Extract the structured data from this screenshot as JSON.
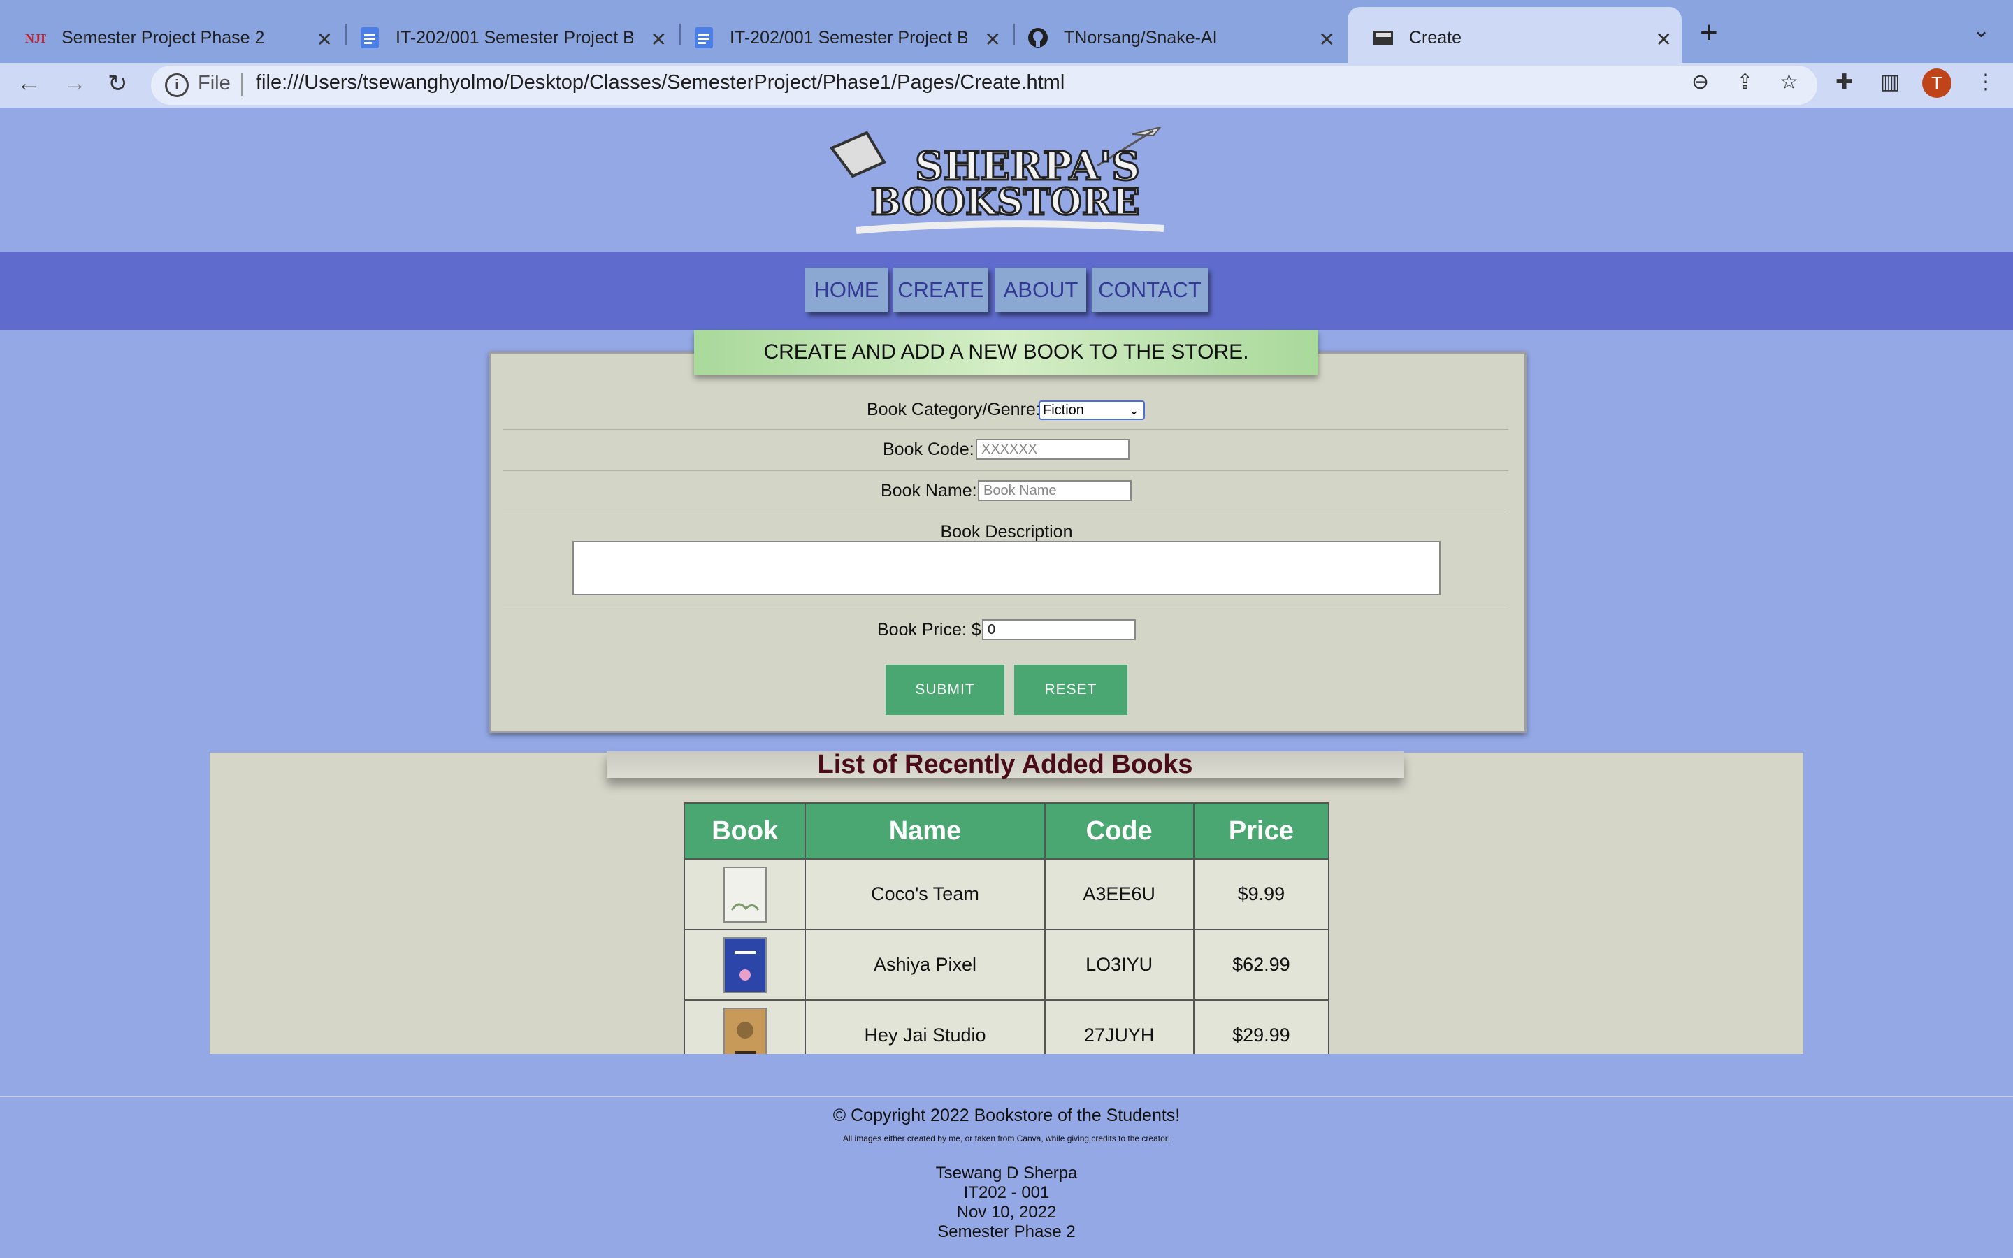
{
  "browser": {
    "tabs": [
      {
        "title": "Semester Project Phase 2",
        "icon": "njit-icon"
      },
      {
        "title": "IT-202/001 Semester Project B",
        "icon": "docs-icon"
      },
      {
        "title": "IT-202/001 Semester Project B",
        "icon": "docs-icon"
      },
      {
        "title": "TNorsang/Snake-AI",
        "icon": "github-icon"
      },
      {
        "title": "Create",
        "icon": "page-icon",
        "active": true
      }
    ],
    "omnibox_scheme": "File",
    "url": "file:///Users/tsewanghyolmo/Desktop/Classes/SemesterProject/Phase1/Pages/Create.html",
    "profile_initial": "T"
  },
  "logo": {
    "line1": "SHERPA'S",
    "line2": "BOOKSTORE"
  },
  "nav": [
    "HOME",
    "CREATE",
    "ABOUT",
    "CONTACT"
  ],
  "form": {
    "banner": "CREATE AND ADD A NEW BOOK TO THE STORE.",
    "category_label": "Book Category/Genre:",
    "category_value": "Fiction",
    "code_label": "Book Code:",
    "code_placeholder": "XXXXXX",
    "name_label": "Book Name:",
    "name_placeholder": "Book Name",
    "description_label": "Book Description",
    "price_label": "Book Price: $",
    "price_value": "0",
    "submit_label": "SUBMIT",
    "reset_label": "RESET"
  },
  "list": {
    "title": "List of Recently Added Books",
    "columns": [
      "Book",
      "Name",
      "Code",
      "Price"
    ],
    "rows": [
      {
        "name": "Coco's Team",
        "code": "A3EE6U",
        "price": "$9.99"
      },
      {
        "name": "Ashiya Pixel",
        "code": "LO3IYU",
        "price": "$62.99"
      },
      {
        "name": "Hey Jai Studio",
        "code": "27JUYH",
        "price": "$29.99"
      }
    ]
  },
  "footer": {
    "copyright": "© Copyright 2022 Bookstore of the Students!",
    "credits": "All images either created by me, or taken from Canva, while giving credits to the creator!",
    "author": "Tsewang D Sherpa",
    "course": "IT202 - 001",
    "date": "Nov 10, 2022",
    "phase": "Semester Phase 2"
  },
  "colors": {
    "page_bg": "#94a8e6",
    "navbar_bg": "#5f6ccd",
    "accent_green": "#4ba772",
    "list_title": "#4a0c19"
  }
}
